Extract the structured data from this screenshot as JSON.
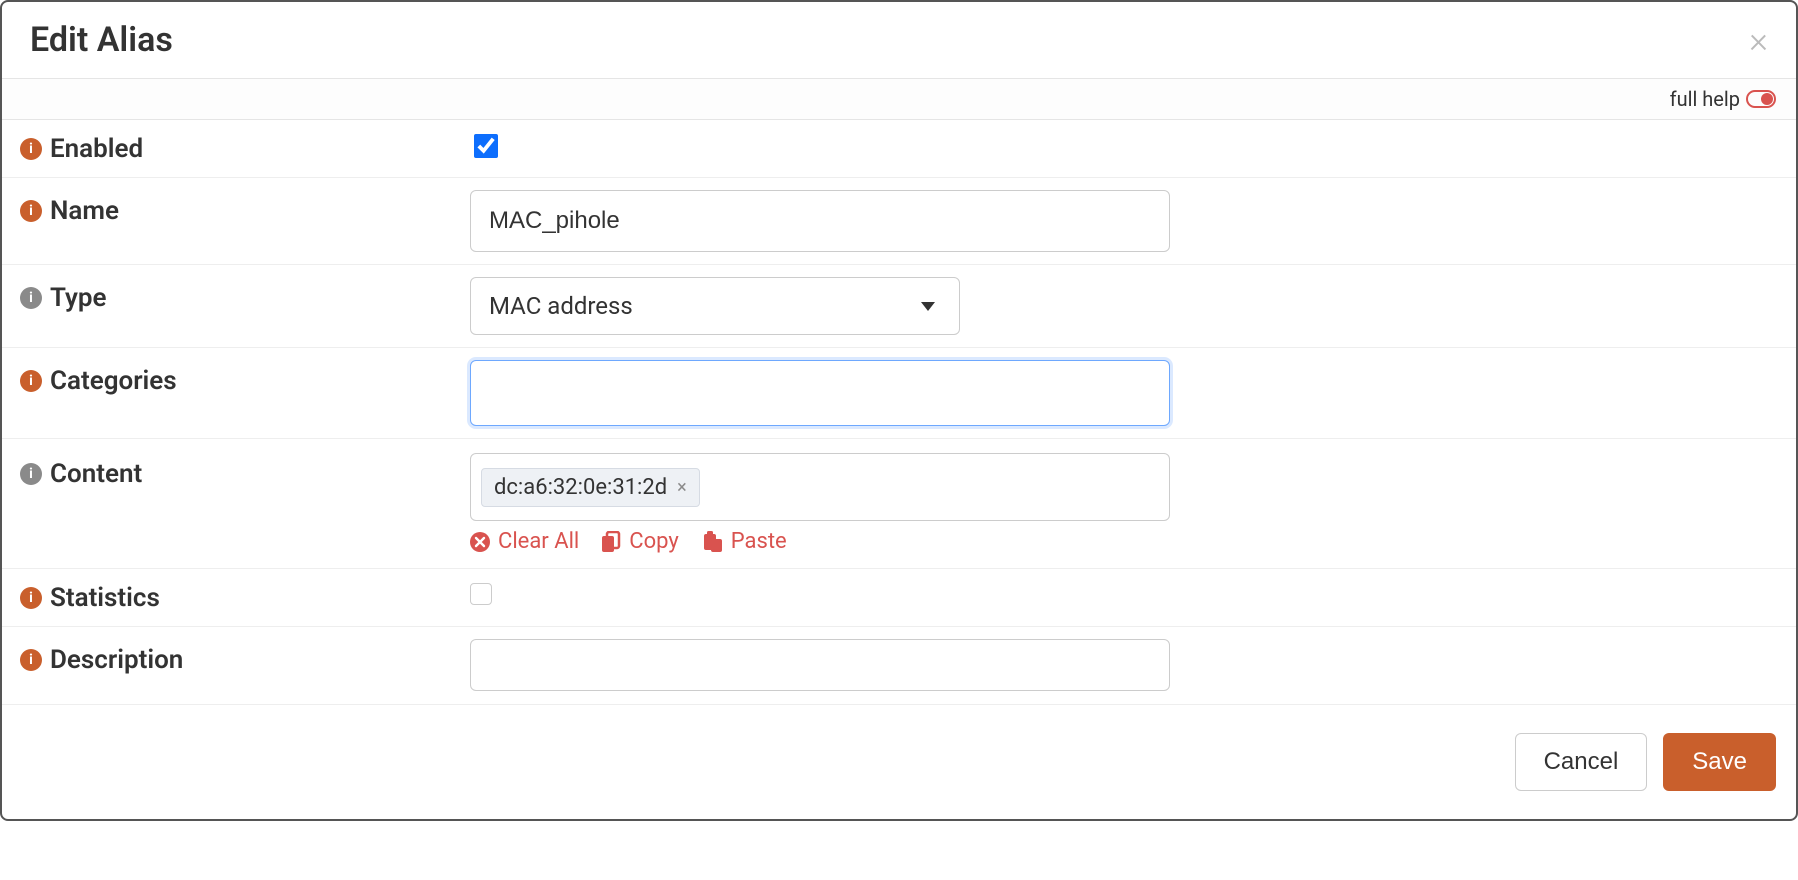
{
  "modal": {
    "title": "Edit Alias",
    "close_symbol": "×",
    "full_help_label": "full help"
  },
  "fields": {
    "enabled": {
      "label": "Enabled",
      "checked": true
    },
    "name": {
      "label": "Name",
      "value": "MAC_pihole"
    },
    "type": {
      "label": "Type",
      "selected": "MAC address"
    },
    "categories": {
      "label": "Categories",
      "value": ""
    },
    "content": {
      "label": "Content",
      "tags": [
        "dc:a6:32:0e:31:2d"
      ],
      "actions": {
        "clear_all": "Clear All",
        "copy": "Copy",
        "paste": "Paste"
      }
    },
    "statistics": {
      "label": "Statistics",
      "checked": false
    },
    "description": {
      "label": "Description",
      "value": ""
    }
  },
  "footer": {
    "cancel": "Cancel",
    "save": "Save"
  }
}
